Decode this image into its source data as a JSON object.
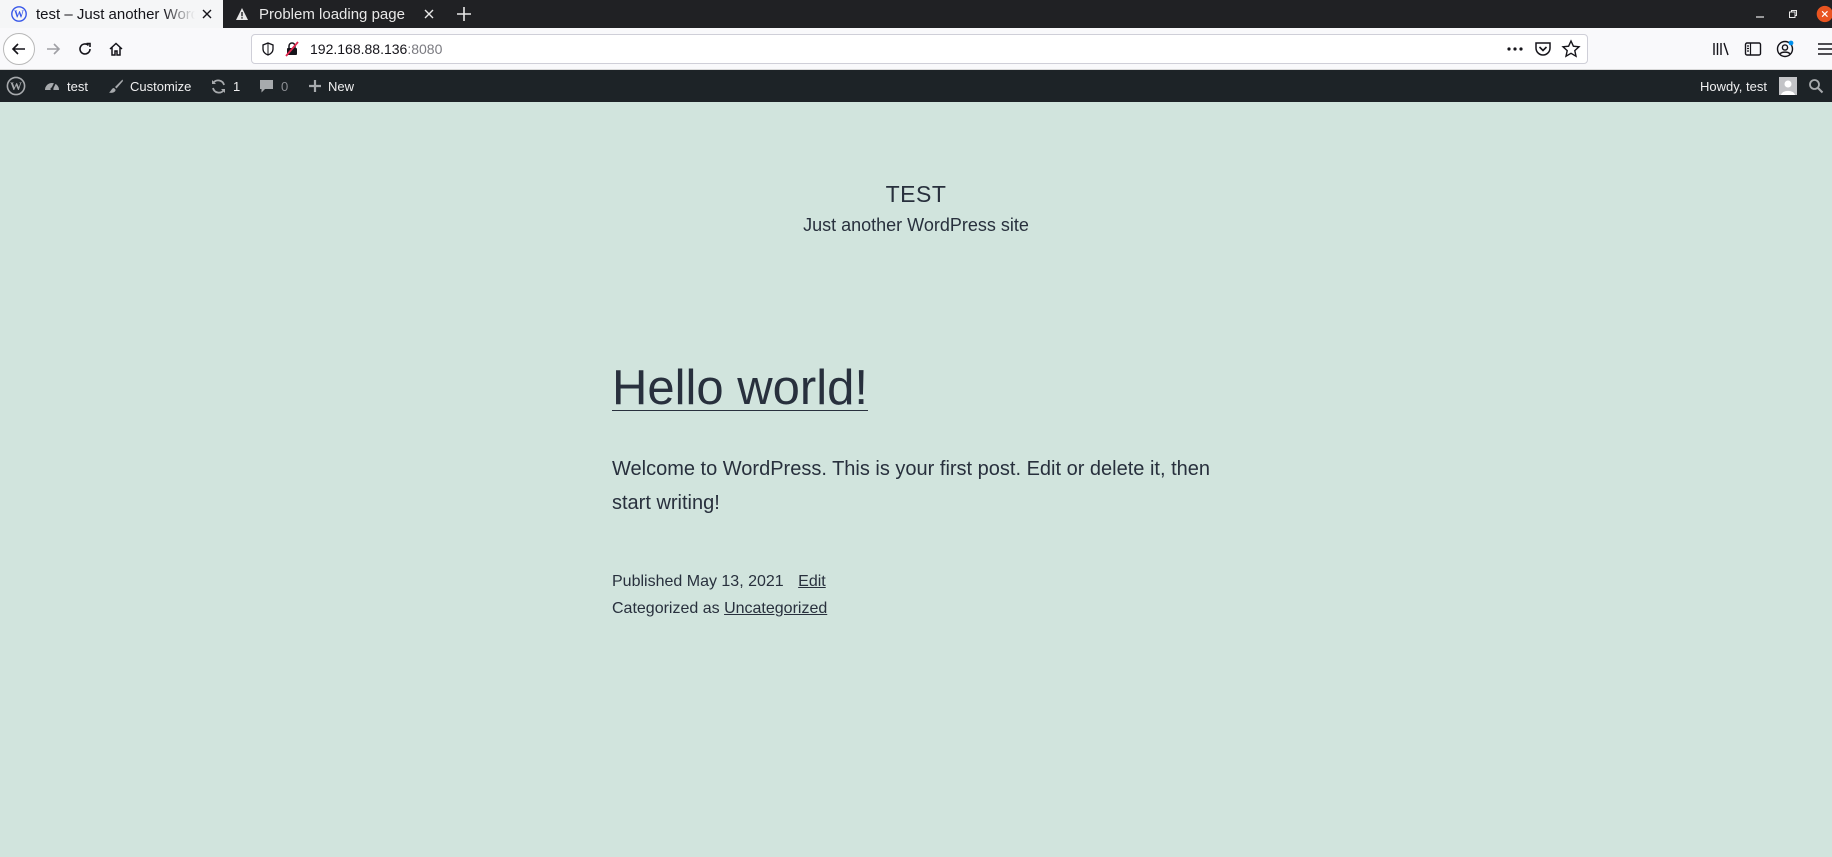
{
  "browser": {
    "tabs": [
      {
        "title": "test – Just another WordPress site",
        "active": true,
        "icon": "wordpress-icon"
      },
      {
        "title": "Problem loading page",
        "active": false,
        "icon": "warning-icon"
      }
    ],
    "url": {
      "host": "192.168.88.136",
      "port": ":8080"
    }
  },
  "adminbar": {
    "site_name": "test",
    "customize": "Customize",
    "updates_count": "1",
    "comments_count": "0",
    "new_label": "New",
    "howdy": "Howdy, test"
  },
  "site": {
    "title": "TEST",
    "tagline": "Just another WordPress site"
  },
  "post": {
    "title": "Hello world!",
    "body": "Welcome to WordPress. This is your first post. Edit or delete it, then start writing!",
    "published_prefix": "Published",
    "published_date": "May 13, 2021",
    "edit_label": "Edit",
    "categorized_prefix": "Categorized as",
    "category": "Uncategorized"
  },
  "colors": {
    "page_background": "#d1e4dd",
    "text": "#28303d",
    "adminbar": "#1d2327",
    "tabstrip": "#202124"
  }
}
